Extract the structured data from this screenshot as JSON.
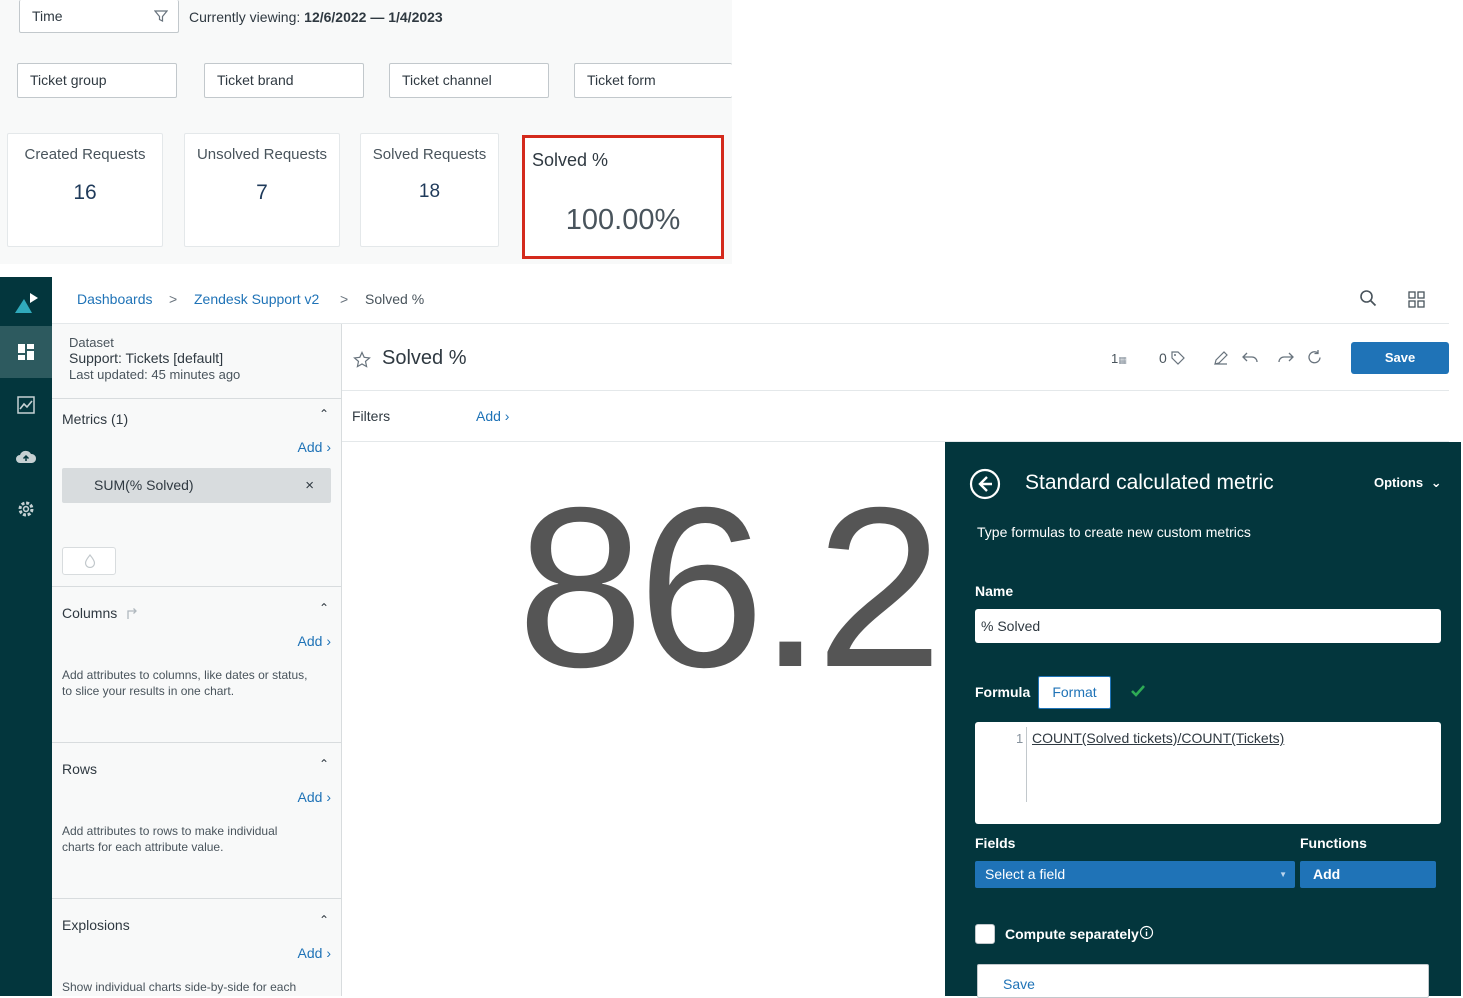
{
  "top_dashboard": {
    "time_filter": "Time",
    "viewing_prefix": "Currently viewing:",
    "viewing_range": "12/6/2022 — 1/4/2023",
    "filters": [
      "Ticket group",
      "Ticket brand",
      "Ticket channel",
      "Ticket form"
    ],
    "kpis": [
      {
        "title": "Created Requests",
        "value": "16"
      },
      {
        "title": "Unsolved Requests",
        "value": "7"
      },
      {
        "title": "Solved Requests",
        "value": "18"
      }
    ],
    "highlight_kpi": {
      "title": "Solved %",
      "value": "100.00%"
    },
    "highlight_color": "#d42a1c"
  },
  "breadcrumb": {
    "dashboards": "Dashboards",
    "sep": ">",
    "dataset_link": "Zendesk Support v2",
    "current": "Solved %"
  },
  "dataset": {
    "label": "Dataset",
    "name": "Support: Tickets [default]",
    "updated": "Last updated: 45 minutes ago"
  },
  "sidebar": {
    "metrics": {
      "title": "Metrics (1)",
      "add": "Add ›",
      "chip": "SUM(% Solved)",
      "chip_remove": "×"
    },
    "columns": {
      "title": "Columns",
      "add": "Add ›",
      "help": "Add attributes to columns, like dates or status, to slice your results in one chart."
    },
    "rows": {
      "title": "Rows",
      "add": "Add ›",
      "help": "Add attributes to rows to make individual charts for each attribute value."
    },
    "explosions": {
      "title": "Explosions",
      "add": "Add ›",
      "help": "Show individual charts side-by-side for each"
    }
  },
  "report": {
    "title": "Solved %",
    "count_one": "1",
    "count_two": "0",
    "save": "Save",
    "filters_label": "Filters",
    "filters_add": "Add ›",
    "big_value": "86.2"
  },
  "metric_editor": {
    "title": "Standard calculated metric",
    "options": "Options",
    "subtitle": "Type formulas to create new custom metrics",
    "name_label": "Name",
    "name_value": "% Solved",
    "formula_label": "Formula",
    "format_button": "Format",
    "line_number": "1",
    "formula_part1": "COUNT(Solved tickets)",
    "formula_op": "/",
    "formula_part2": "COUNT(Tickets)",
    "fields_label": "Fields",
    "functions_label": "Functions",
    "select_field": "Select a field",
    "functions_add": "Add",
    "compute_label": "Compute separately",
    "save": "Save"
  },
  "colors": {
    "brand_dark": "#03363d",
    "link": "#1f73b7",
    "success": "#2eab55"
  }
}
